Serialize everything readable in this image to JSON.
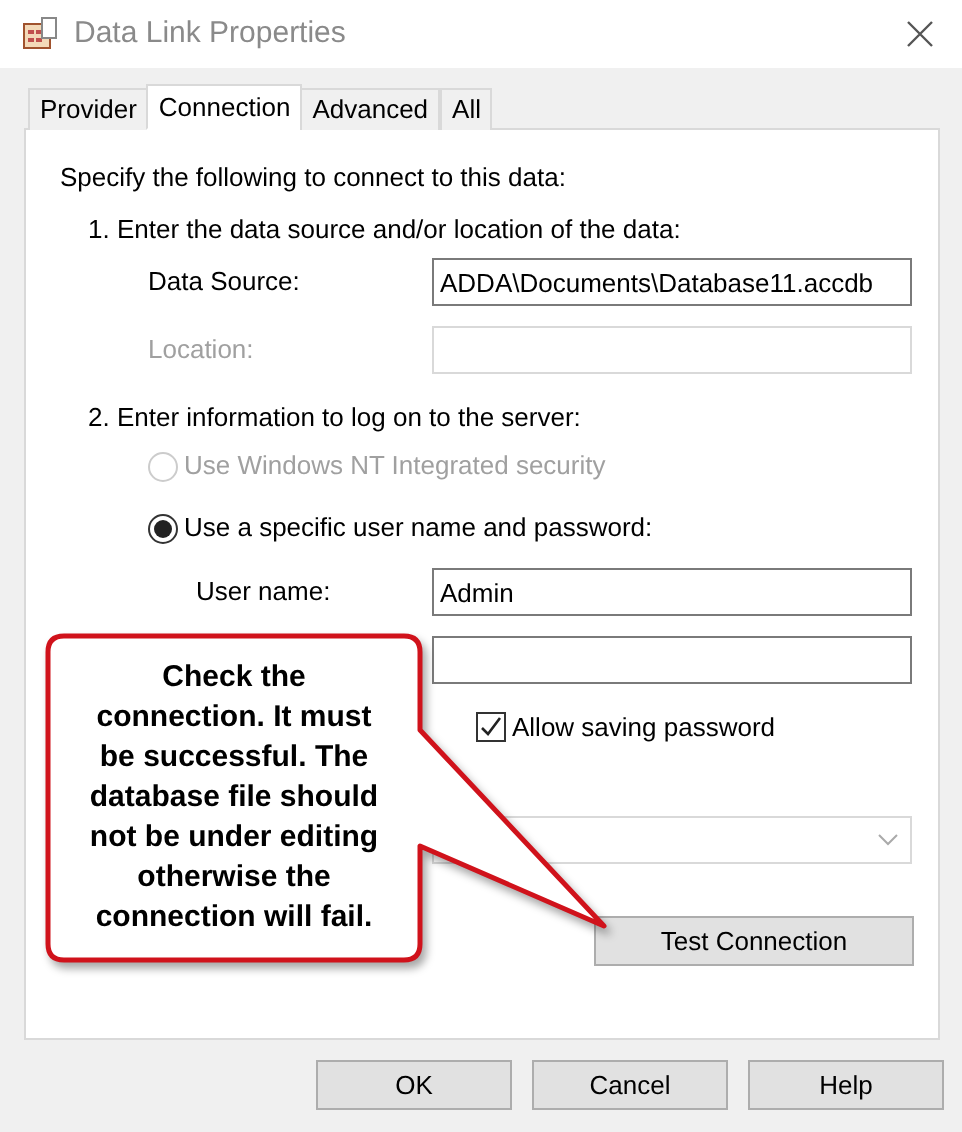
{
  "window": {
    "title": "Data Link Properties"
  },
  "tabs": [
    {
      "label": "Provider",
      "selected": false
    },
    {
      "label": "Connection",
      "selected": true
    },
    {
      "label": "Advanced",
      "selected": false
    },
    {
      "label": "All",
      "selected": false
    }
  ],
  "intro": "Specify the following to connect to this data:",
  "step1": {
    "heading": "1. Enter the data source and/or location of the data:",
    "fields": [
      {
        "label": "Data Source:",
        "value": "ADDA\\Documents\\Database11.accdb",
        "disabled": false
      },
      {
        "label": "Location:",
        "disabled": true
      }
    ]
  },
  "step2": {
    "heading": "2. Enter information to log on to the server:",
    "options": [
      {
        "label": "Use Windows NT Integrated security",
        "selected": false,
        "disabled": true
      },
      {
        "label": "Use a specific user name and password:",
        "selected": true,
        "disabled": false
      }
    ],
    "fields": [
      {
        "kind": "text",
        "label": "User name:",
        "value": "Admin"
      },
      {
        "kind": "password"
      }
    ],
    "save_password": {
      "label": "Allow saving password",
      "checked": true
    }
  },
  "test_button": "Test Connection",
  "callout": "Check the connection. It must be successful. The database file should not be under editing otherwise the connection will fail.",
  "buttons": [
    "OK",
    "Cancel",
    "Help"
  ]
}
